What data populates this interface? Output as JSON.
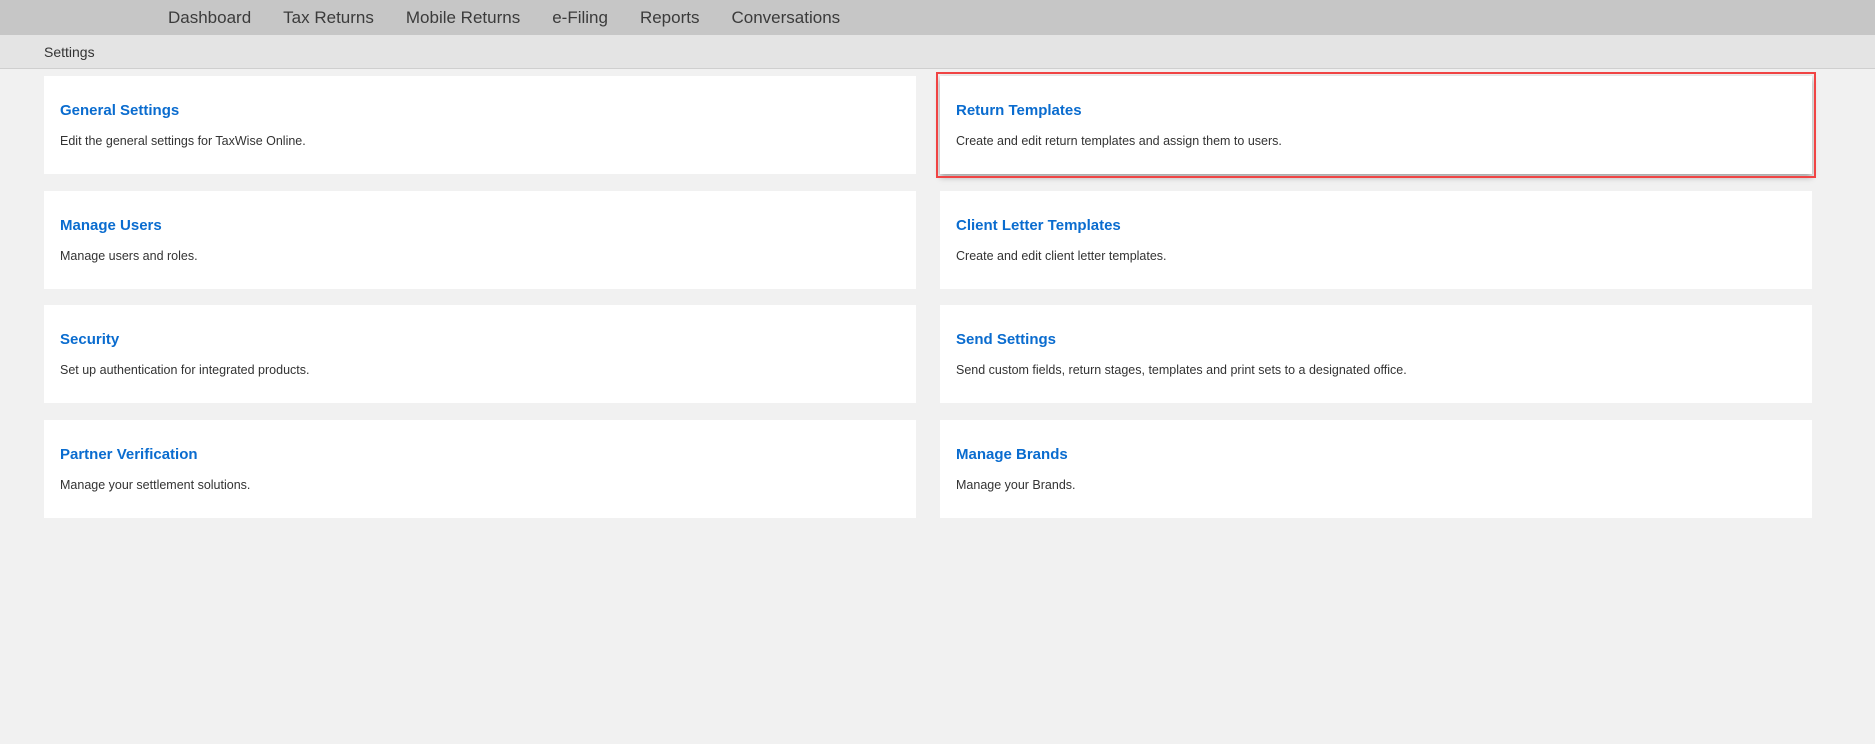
{
  "nav": [
    "Dashboard",
    "Tax Returns",
    "Mobile Returns",
    "e-Filing",
    "Reports",
    "Conversations"
  ],
  "breadcrumb": "Settings",
  "cards": [
    {
      "title": "General Settings",
      "desc": "Edit the general settings for TaxWise Online."
    },
    {
      "title": "Return Templates",
      "desc": "Create and edit return templates and assign them to users."
    },
    {
      "title": "Manage Users",
      "desc": "Manage users and roles."
    },
    {
      "title": "Client Letter Templates",
      "desc": "Create and edit client letter templates."
    },
    {
      "title": "Security",
      "desc": "Set up authentication for integrated products."
    },
    {
      "title": "Send Settings",
      "desc": "Send custom fields, return stages, templates and print sets to a designated office."
    },
    {
      "title": "Partner Verification",
      "desc": "Manage your settlement solutions."
    },
    {
      "title": "Manage Brands",
      "desc": "Manage your Brands."
    }
  ],
  "highlight_color": "#f04444",
  "accent": "#0a6ccf"
}
